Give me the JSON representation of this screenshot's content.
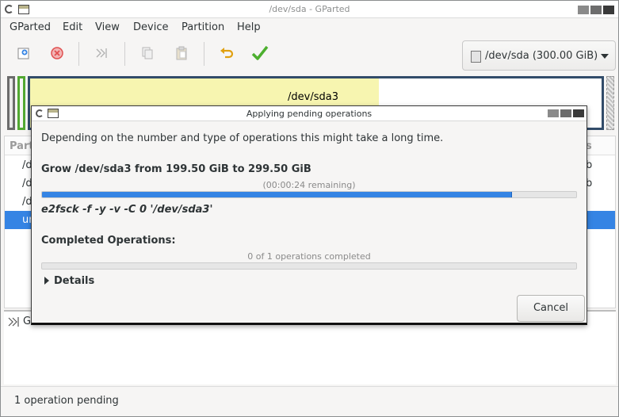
{
  "window": {
    "title": "/dev/sda - GParted"
  },
  "menubar": {
    "items": [
      "GParted",
      "Edit",
      "View",
      "Device",
      "Partition",
      "Help"
    ]
  },
  "toolbar": {
    "icons": [
      "new-partition-icon",
      "delete-icon",
      "resize-move-icon",
      "copy-icon",
      "paste-icon",
      "undo-icon",
      "apply-icon"
    ],
    "device": "/dev/sda (300.00 GiB)"
  },
  "partition_map": {
    "label": "/dev/sda3"
  },
  "partition_list": {
    "header_left": "Part",
    "header_right": "s",
    "rows": [
      {
        "left": "/d",
        "right": "b",
        "selected": false
      },
      {
        "left": "/d",
        "right": "b",
        "selected": false
      },
      {
        "left": "/d",
        "right": "",
        "selected": false
      },
      {
        "left": "ur",
        "right": "",
        "selected": true
      }
    ]
  },
  "pending_pane": {
    "item": "G"
  },
  "statusbar": {
    "text": "1 operation pending"
  },
  "dialog": {
    "title": "Applying pending operations",
    "intro": "Depending on the number and type of operations this might take a long time.",
    "operation": "Grow /dev/sda3 from 199.50 GiB to 299.50 GiB",
    "remaining": "(00:00:24 remaining)",
    "operation_progress": 0.88,
    "command": "e2fsck -f -y -v -C 0 '/dev/sda3'",
    "completed_title": "Completed Operations:",
    "completed_count": "0 of 1 operations completed",
    "completed_progress": 0.0,
    "details_label": "Details",
    "cancel_label": "Cancel"
  },
  "colors": {
    "accent": "#3584e4",
    "partition_fill": "#f7f5b0",
    "partition_border": "#324c6a",
    "apply_green": "#4caf2e",
    "undo_orange": "#e0a010",
    "delete_red": "#e05050"
  }
}
